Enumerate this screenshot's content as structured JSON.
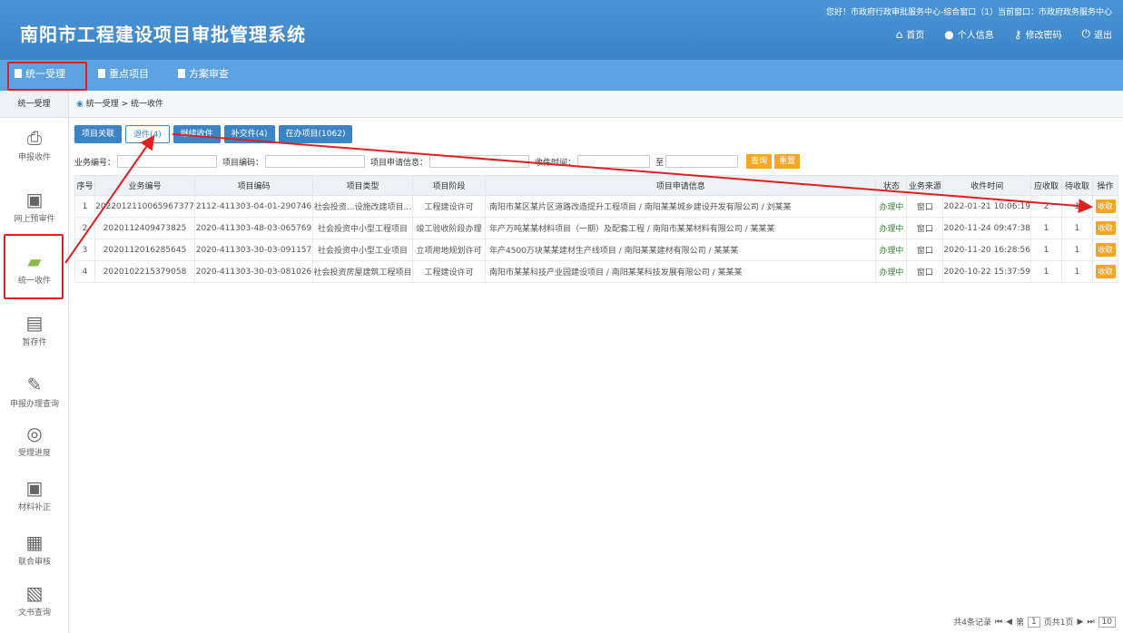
{
  "header": {
    "title": "南阳市工程建设项目审批管理系统",
    "user_info": "您好！市政府行政审批服务中心-综合窗口（1）当前窗口：市政府政务服务中心",
    "tools": [
      {
        "label": "首页",
        "icon": "home-icon"
      },
      {
        "label": "个人信息",
        "icon": "user-icon"
      },
      {
        "label": "修改密码",
        "icon": "key-icon"
      },
      {
        "label": "退出",
        "icon": "power-icon"
      }
    ]
  },
  "nav": {
    "items": [
      "统一受理",
      "重点项目",
      "方案审查"
    ]
  },
  "sidebar": {
    "head": "统一受理",
    "items": [
      {
        "label": "申报收件",
        "icon": "inbox-icon"
      },
      {
        "label": "网上预审件",
        "icon": "monitor-icon"
      },
      {
        "label": "统一收件",
        "icon": "folder-icon"
      },
      {
        "label": "暂存件",
        "icon": "save-icon"
      },
      {
        "label": "申报办理查询",
        "icon": "edit-icon"
      },
      {
        "label": "受理进度",
        "icon": "progress-icon"
      },
      {
        "label": "材料补正",
        "icon": "document-icon"
      },
      {
        "label": "联合审核",
        "icon": "calendar-icon"
      },
      {
        "label": "文书查询",
        "icon": "file-icon"
      }
    ]
  },
  "breadcrumb": "统一受理 > 统一收件",
  "tabs": [
    "项目关联",
    "退件(4)",
    "继续收件",
    "补交件(4)",
    "在办项目(1062)"
  ],
  "search": {
    "fields": [
      "业务编号：",
      "项目编码：",
      "项目申请信息：",
      "收件时间："
    ],
    "to": "至",
    "query": "查询",
    "reset": "重置"
  },
  "table": {
    "headers": [
      "序号",
      "业务编号",
      "项目编码",
      "项目类型",
      "项目阶段",
      "项目申请信息",
      "状态",
      "业务来源",
      "收件时间",
      "应收取",
      "待收取",
      "操作"
    ],
    "rows": [
      [
        "1",
        "2022012110065967377",
        "2112-411303-04-01-290746",
        "社会投资...设施改建项目...",
        "工程建设许可",
        "南阳市某区某片区道路改造提升工程项目 / 南阳某某城乡建设开发有限公司 / 刘某某",
        "办理中",
        "窗口",
        "2022-01-21 10:06:19",
        "2",
        "1",
        "收取"
      ],
      [
        "2",
        "2020112409473825",
        "2020-411303-48-03-065769",
        "社会投资中小型工程项目",
        "竣工验收阶段办理",
        "年产万吨某某材料项目（一期）及配套工程 / 南阳市某某材料有限公司 / 某某某",
        "办理中",
        "窗口",
        "2020-11-24 09:47:38",
        "1",
        "1",
        "收取"
      ],
      [
        "3",
        "2020112016285645",
        "2020-411303-30-03-091157",
        "社会投资中小型工业项目",
        "立项用地规划许可",
        "年产4500万块某某建材生产线项目 / 南阳某某建材有限公司 / 某某某",
        "办理中",
        "窗口",
        "2020-11-20 16:28:56",
        "1",
        "1",
        "收取"
      ],
      [
        "4",
        "2020102215379058",
        "2020-411303-30-03-081026",
        "社会投资房屋建筑工程项目",
        "工程建设许可",
        "南阳市某某科技产业园建设项目 / 南阳某某科技发展有限公司 / 某某某",
        "办理中",
        "窗口",
        "2020-10-22 15:37:59",
        "1",
        "1",
        "收取"
      ]
    ]
  },
  "pager": {
    "summary": "共4条记录",
    "page_label": "第",
    "page": "1",
    "total": "页共1页",
    "size": "10"
  }
}
